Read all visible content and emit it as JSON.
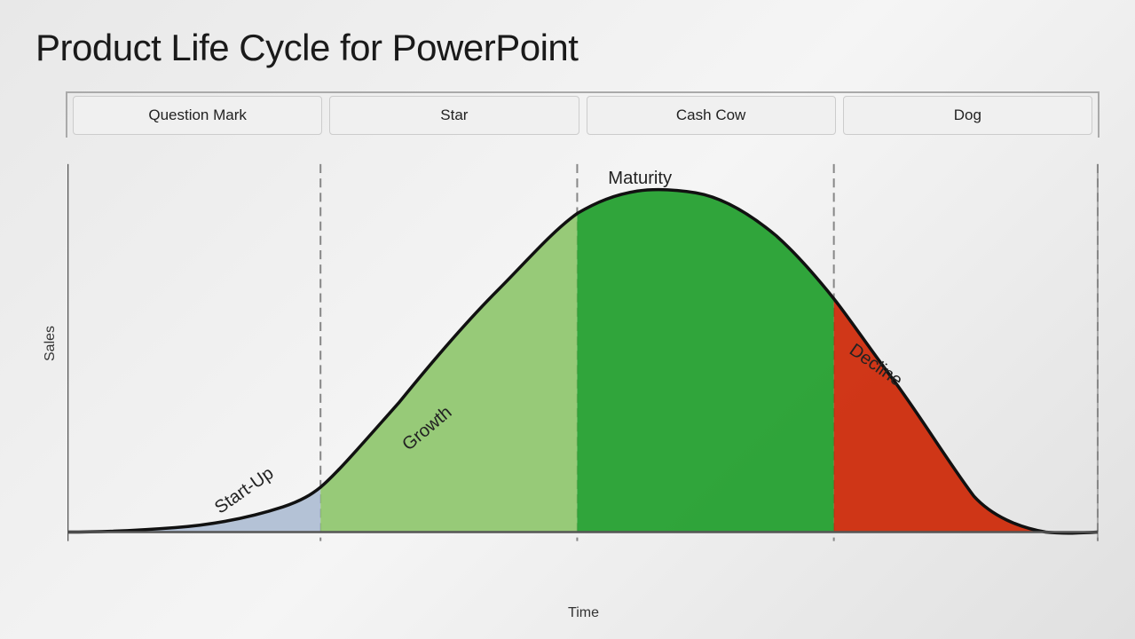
{
  "title": "Product Life Cycle for PowerPoint",
  "yAxisLabel": "Sales",
  "xAxisLabel": "Time",
  "categories": [
    {
      "id": "question-mark",
      "label": "Question Mark"
    },
    {
      "id": "star",
      "label": "Star"
    },
    {
      "id": "cash-cow",
      "label": "Cash Cow"
    },
    {
      "id": "dog",
      "label": "Dog"
    }
  ],
  "phases": [
    {
      "id": "startup",
      "label": "Start-Up",
      "color": "#a8b8d8"
    },
    {
      "id": "growth",
      "label": "Growth",
      "color": "#8ec06c"
    },
    {
      "id": "maturity",
      "label": "Maturity",
      "color": "#2da033"
    },
    {
      "id": "decline",
      "label": "Decline",
      "color": "#cc2200"
    }
  ],
  "colors": {
    "startup": "#a8b8d0",
    "growth": "#8dc56a",
    "maturity": "#25a030",
    "decline": "#cc2200",
    "curve": "#111111",
    "axis": "#555555",
    "dashed": "#888888"
  }
}
